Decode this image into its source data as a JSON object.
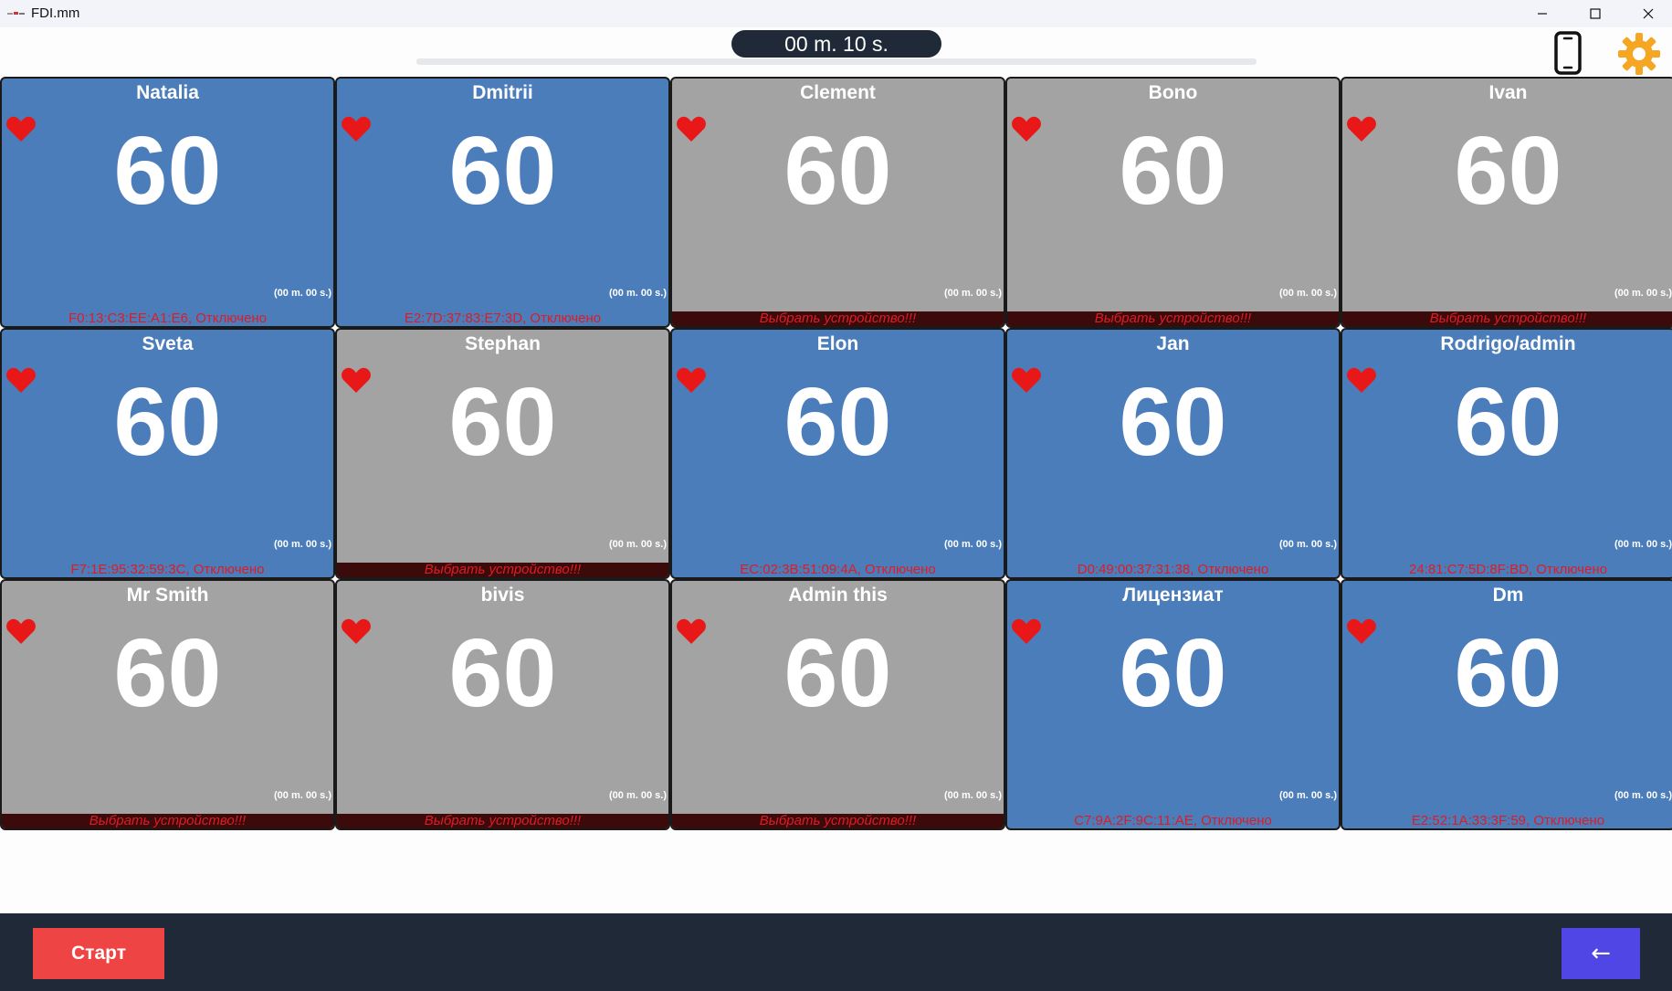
{
  "window": {
    "title": "FDI.mm"
  },
  "header": {
    "timer": "00 m. 10 s.",
    "progress": 0.0
  },
  "colors": {
    "active_tile": "#4b7dbb",
    "inactive_tile": "#a3a3a3",
    "status_text": "#e01b24",
    "gear": "#f5a623",
    "start": "#ef4444",
    "back": "#4f46e5"
  },
  "icons": {
    "phone": "smartphone-icon",
    "settings": "gear-icon",
    "heart": "heart-icon",
    "back": "left-arrow-icon"
  },
  "tiles": [
    {
      "name": "Natalia",
      "bpm": "60",
      "time": "(00 m. 00 s.)",
      "status": "F0:13:C3:EE:A1:E6, Отключено",
      "active": true
    },
    {
      "name": "Dmitrii",
      "bpm": "60",
      "time": "(00 m. 00 s.)",
      "status": "E2:7D:37:83:E7:3D, Отключено",
      "active": true
    },
    {
      "name": "Clement",
      "bpm": "60",
      "time": "(00 m. 00 s.)",
      "status": "Выбрать устройство!!!",
      "active": false
    },
    {
      "name": "Bono",
      "bpm": "60",
      "time": "(00 m. 00 s.)",
      "status": "Выбрать устройство!!!",
      "active": false
    },
    {
      "name": "Ivan",
      "bpm": "60",
      "time": "(00 m. 00 s.)",
      "status": "Выбрать устройство!!!",
      "active": false
    },
    {
      "name": "Sveta",
      "bpm": "60",
      "time": "(00 m. 00 s.)",
      "status": "F7:1E:95:32:59:3C, Отключено",
      "active": true
    },
    {
      "name": "Stephan",
      "bpm": "60",
      "time": "(00 m. 00 s.)",
      "status": "Выбрать устройство!!!",
      "active": false
    },
    {
      "name": "Elon",
      "bpm": "60",
      "time": "(00 m. 00 s.)",
      "status": "EC:02:3B:51:09:4A, Отключено",
      "active": true
    },
    {
      "name": "Jan",
      "bpm": "60",
      "time": "(00 m. 00 s.)",
      "status": "D0:49:00:37:31:38, Отключено",
      "active": true
    },
    {
      "name": "Rodrigo/admin",
      "bpm": "60",
      "time": "(00 m. 00 s.)",
      "status": "24:81:C7:5D:8F:BD, Отключено",
      "active": true
    },
    {
      "name": "Mr Smith",
      "bpm": "60",
      "time": "(00 m. 00 s.)",
      "status": "Выбрать устройство!!!",
      "active": false
    },
    {
      "name": "bivis",
      "bpm": "60",
      "time": "(00 m. 00 s.)",
      "status": "Выбрать устройство!!!",
      "active": false
    },
    {
      "name": "Admin this",
      "bpm": "60",
      "time": "(00 m. 00 s.)",
      "status": "Выбрать устройство!!!",
      "active": false
    },
    {
      "name": "Лицензиат",
      "bpm": "60",
      "time": "(00 m. 00 s.)",
      "status": "C7:9A:2F:9C:11:AE, Отключено",
      "active": true
    },
    {
      "name": "Dm",
      "bpm": "60",
      "time": "(00 m. 00 s.)",
      "status": "E2:52:1A:33:3F:59, Отключено",
      "active": true
    }
  ],
  "footer": {
    "start_label": "Старт",
    "back_label": "←"
  }
}
